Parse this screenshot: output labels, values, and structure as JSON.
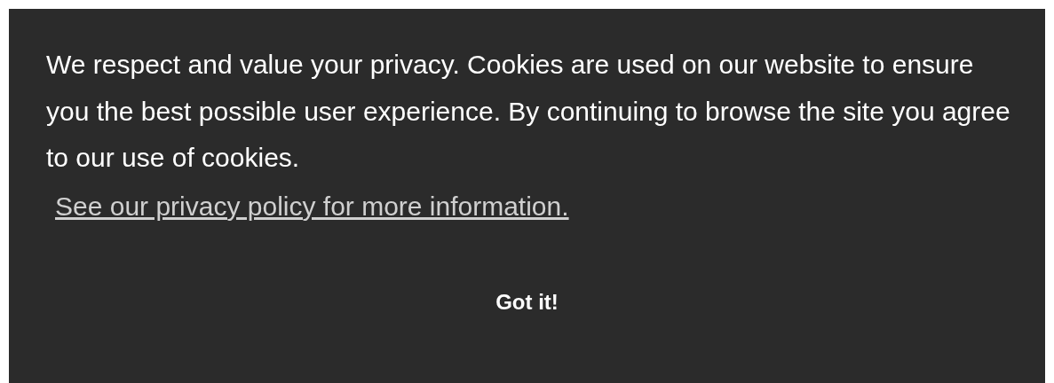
{
  "cookie_banner": {
    "message": "We respect and value your privacy. Cookies are used on our website to ensure you the best possible user experience. By continuing to browse the site you agree to our use of cookies.",
    "link": "See our privacy policy for more information.",
    "button": "Got it!"
  }
}
